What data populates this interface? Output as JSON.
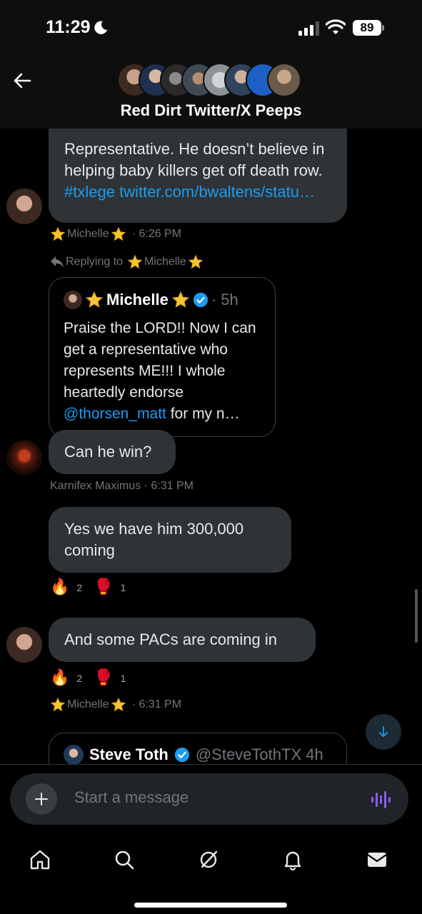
{
  "status_bar": {
    "time": "11:29",
    "battery": "89",
    "icons": [
      "moon-icon",
      "signal-icon",
      "wifi-icon",
      "battery-icon"
    ]
  },
  "header": {
    "title": "Red Dirt Twitter/X Peeps",
    "back_icon": "arrow-left-icon",
    "avatar_colors": [
      "#6b4a3a",
      "#2b3a52",
      "#3b3b3b",
      "#4a4a4a",
      "#9a9fa5",
      "#3b4f6b",
      "#1d5fc4",
      "#8a7a6a"
    ]
  },
  "messages": {
    "m1": {
      "text_plain": "Representative. He doesn’t believe in helping baby killers get off death row. ",
      "link_text": "#txlege twitter.com/bwaltens/statu…",
      "hashtag": "#txlege",
      "url": "twitter.com/bwaltens/",
      "url_tail": "statu…",
      "meta_name": "Michelle",
      "meta_time": "· 6:26 PM"
    },
    "reply_context": {
      "label": "Replying to",
      "name": "Michelle"
    },
    "quote1": {
      "name": "Michelle",
      "time": "· 5h",
      "text_plain": "Praise the LORD!! Now I can get a representative who represents ME!!! I whole heartedly endorse ",
      "mention": "@thorsen_matt",
      "text_tail": " for my n…"
    },
    "m2": {
      "text": "Can he win?",
      "meta": "Karnifex Maximus · 6:31 PM"
    },
    "m3": {
      "text": "Yes we have him 300,000 coming",
      "reactions": [
        {
          "emoji": "🔥",
          "count": "2"
        },
        {
          "emoji": "🥊",
          "count": "1"
        }
      ]
    },
    "m4": {
      "text": "And some PACs are coming in",
      "reactions": [
        {
          "emoji": "🔥",
          "count": "2"
        },
        {
          "emoji": "🥊",
          "count": "1"
        }
      ],
      "meta_name": "Michelle",
      "meta_time": "· 6:31 PM"
    },
    "quote2": {
      "name": "Steve Toth",
      "handle": "@SteveTothTX 4h"
    }
  },
  "composer": {
    "placeholder": "Start a message",
    "plus_icon": "plus-icon",
    "voice_icon": "voice-wave-icon"
  },
  "tabbar": {
    "tabs": [
      "home-icon",
      "search-icon",
      "grok-icon",
      "notifications-icon",
      "messages-icon"
    ]
  },
  "colors": {
    "accent": "#1d9bf0",
    "bubble": "#2f3336",
    "verified": "#1d9bf0"
  }
}
